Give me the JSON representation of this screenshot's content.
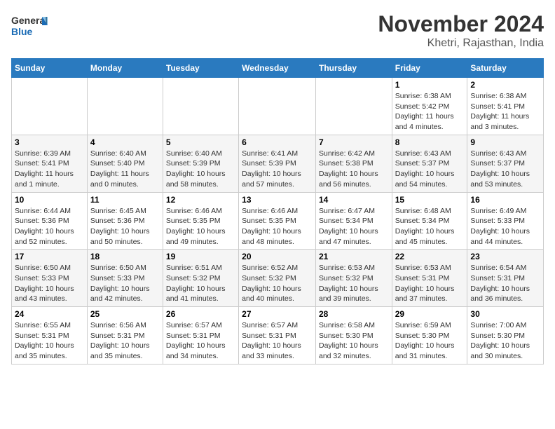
{
  "header": {
    "logo_line1": "General",
    "logo_line2": "Blue",
    "month": "November 2024",
    "location": "Khetri, Rajasthan, India"
  },
  "weekdays": [
    "Sunday",
    "Monday",
    "Tuesday",
    "Wednesday",
    "Thursday",
    "Friday",
    "Saturday"
  ],
  "weeks": [
    [
      {
        "day": "",
        "info": ""
      },
      {
        "day": "",
        "info": ""
      },
      {
        "day": "",
        "info": ""
      },
      {
        "day": "",
        "info": ""
      },
      {
        "day": "",
        "info": ""
      },
      {
        "day": "1",
        "info": "Sunrise: 6:38 AM\nSunset: 5:42 PM\nDaylight: 11 hours and 4 minutes."
      },
      {
        "day": "2",
        "info": "Sunrise: 6:38 AM\nSunset: 5:41 PM\nDaylight: 11 hours and 3 minutes."
      }
    ],
    [
      {
        "day": "3",
        "info": "Sunrise: 6:39 AM\nSunset: 5:41 PM\nDaylight: 11 hours and 1 minute."
      },
      {
        "day": "4",
        "info": "Sunrise: 6:40 AM\nSunset: 5:40 PM\nDaylight: 11 hours and 0 minutes."
      },
      {
        "day": "5",
        "info": "Sunrise: 6:40 AM\nSunset: 5:39 PM\nDaylight: 10 hours and 58 minutes."
      },
      {
        "day": "6",
        "info": "Sunrise: 6:41 AM\nSunset: 5:39 PM\nDaylight: 10 hours and 57 minutes."
      },
      {
        "day": "7",
        "info": "Sunrise: 6:42 AM\nSunset: 5:38 PM\nDaylight: 10 hours and 56 minutes."
      },
      {
        "day": "8",
        "info": "Sunrise: 6:43 AM\nSunset: 5:37 PM\nDaylight: 10 hours and 54 minutes."
      },
      {
        "day": "9",
        "info": "Sunrise: 6:43 AM\nSunset: 5:37 PM\nDaylight: 10 hours and 53 minutes."
      }
    ],
    [
      {
        "day": "10",
        "info": "Sunrise: 6:44 AM\nSunset: 5:36 PM\nDaylight: 10 hours and 52 minutes."
      },
      {
        "day": "11",
        "info": "Sunrise: 6:45 AM\nSunset: 5:36 PM\nDaylight: 10 hours and 50 minutes."
      },
      {
        "day": "12",
        "info": "Sunrise: 6:46 AM\nSunset: 5:35 PM\nDaylight: 10 hours and 49 minutes."
      },
      {
        "day": "13",
        "info": "Sunrise: 6:46 AM\nSunset: 5:35 PM\nDaylight: 10 hours and 48 minutes."
      },
      {
        "day": "14",
        "info": "Sunrise: 6:47 AM\nSunset: 5:34 PM\nDaylight: 10 hours and 47 minutes."
      },
      {
        "day": "15",
        "info": "Sunrise: 6:48 AM\nSunset: 5:34 PM\nDaylight: 10 hours and 45 minutes."
      },
      {
        "day": "16",
        "info": "Sunrise: 6:49 AM\nSunset: 5:33 PM\nDaylight: 10 hours and 44 minutes."
      }
    ],
    [
      {
        "day": "17",
        "info": "Sunrise: 6:50 AM\nSunset: 5:33 PM\nDaylight: 10 hours and 43 minutes."
      },
      {
        "day": "18",
        "info": "Sunrise: 6:50 AM\nSunset: 5:33 PM\nDaylight: 10 hours and 42 minutes."
      },
      {
        "day": "19",
        "info": "Sunrise: 6:51 AM\nSunset: 5:32 PM\nDaylight: 10 hours and 41 minutes."
      },
      {
        "day": "20",
        "info": "Sunrise: 6:52 AM\nSunset: 5:32 PM\nDaylight: 10 hours and 40 minutes."
      },
      {
        "day": "21",
        "info": "Sunrise: 6:53 AM\nSunset: 5:32 PM\nDaylight: 10 hours and 39 minutes."
      },
      {
        "day": "22",
        "info": "Sunrise: 6:53 AM\nSunset: 5:31 PM\nDaylight: 10 hours and 37 minutes."
      },
      {
        "day": "23",
        "info": "Sunrise: 6:54 AM\nSunset: 5:31 PM\nDaylight: 10 hours and 36 minutes."
      }
    ],
    [
      {
        "day": "24",
        "info": "Sunrise: 6:55 AM\nSunset: 5:31 PM\nDaylight: 10 hours and 35 minutes."
      },
      {
        "day": "25",
        "info": "Sunrise: 6:56 AM\nSunset: 5:31 PM\nDaylight: 10 hours and 35 minutes."
      },
      {
        "day": "26",
        "info": "Sunrise: 6:57 AM\nSunset: 5:31 PM\nDaylight: 10 hours and 34 minutes."
      },
      {
        "day": "27",
        "info": "Sunrise: 6:57 AM\nSunset: 5:31 PM\nDaylight: 10 hours and 33 minutes."
      },
      {
        "day": "28",
        "info": "Sunrise: 6:58 AM\nSunset: 5:30 PM\nDaylight: 10 hours and 32 minutes."
      },
      {
        "day": "29",
        "info": "Sunrise: 6:59 AM\nSunset: 5:30 PM\nDaylight: 10 hours and 31 minutes."
      },
      {
        "day": "30",
        "info": "Sunrise: 7:00 AM\nSunset: 5:30 PM\nDaylight: 10 hours and 30 minutes."
      }
    ]
  ]
}
